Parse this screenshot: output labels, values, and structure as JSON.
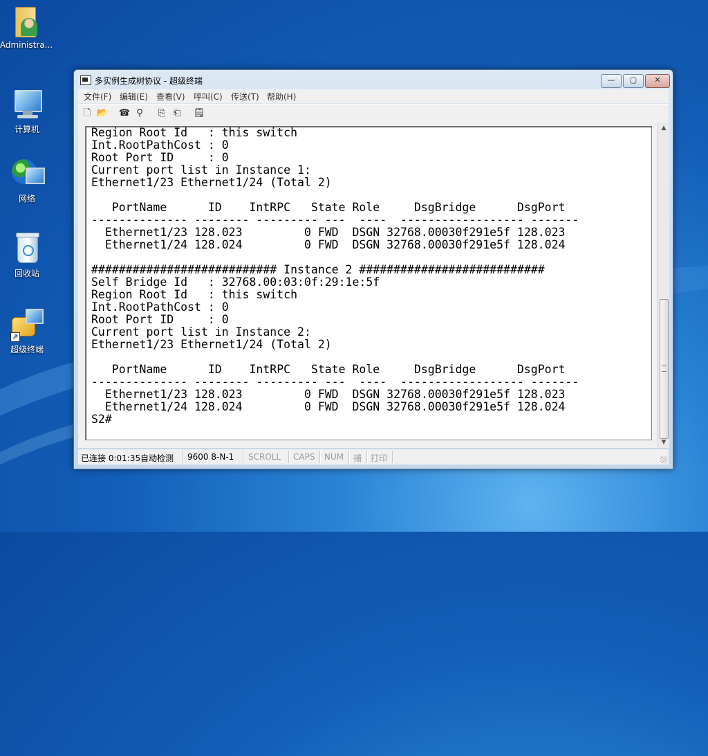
{
  "desktop": {
    "icons": [
      {
        "label": "Administra..."
      },
      {
        "label": "计算机"
      },
      {
        "label": "网络"
      },
      {
        "label": "回收站"
      },
      {
        "label": "超级终端"
      }
    ]
  },
  "window": {
    "title": "多实例生成树协议 - 超级终端",
    "controls": {
      "minimize": "—",
      "maximize": "▢",
      "close": "✕"
    },
    "menu": [
      "文件(F)",
      "编辑(E)",
      "查看(V)",
      "呼叫(C)",
      "传送(T)",
      "帮助(H)"
    ],
    "toolbar": [
      {
        "name": "new-icon",
        "glyph": "🗋"
      },
      {
        "name": "open-icon",
        "glyph": "📂"
      },
      {
        "name": "disconnect-icon",
        "glyph": "☎"
      },
      {
        "name": "call-icon",
        "glyph": "⚲"
      },
      {
        "name": "send-icon",
        "glyph": "⎘"
      },
      {
        "name": "receive-icon",
        "glyph": "⎗"
      },
      {
        "name": "properties-icon",
        "glyph": "🗒"
      }
    ],
    "terminal_lines": [
      "Region Root Id   : this switch",
      "Int.RootPathCost : 0",
      "Root Port ID     : 0",
      "Current port list in Instance 1:",
      "Ethernet1/23 Ethernet1/24 (Total 2)",
      "",
      "   PortName      ID    IntRPC   State Role     DsgBridge      DsgPort",
      "-------------- -------- --------- ---  ----  ------------------ -------",
      "  Ethernet1/23 128.023         0 FWD  DSGN 32768.00030f291e5f 128.023",
      "  Ethernet1/24 128.024         0 FWD  DSGN 32768.00030f291e5f 128.024",
      "",
      "########################### Instance 2 ###########################",
      "Self Bridge Id   : 32768.00:03:0f:29:1e:5f",
      "Region Root Id   : this switch",
      "Int.RootPathCost : 0",
      "Root Port ID     : 0",
      "Current port list in Instance 2:",
      "Ethernet1/23 Ethernet1/24 (Total 2)",
      "",
      "   PortName      ID    IntRPC   State Role     DsgBridge      DsgPort",
      "-------------- -------- --------- ---  ----  ------------------ -------",
      "  Ethernet1/23 128.023         0 FWD  DSGN 32768.00030f291e5f 128.023",
      "  Ethernet1/24 128.024         0 FWD  DSGN 32768.00030f291e5f 128.024",
      "S2#"
    ],
    "scrollbar": {
      "up": "▲",
      "down": "▼"
    },
    "status": {
      "connected": "已连接 0:01:35",
      "detect": "自动检测",
      "baud": "9600 8-N-1",
      "scroll": "SCROLL",
      "caps": "CAPS",
      "num": "NUM",
      "capture": "捕",
      "print": "打印"
    }
  }
}
